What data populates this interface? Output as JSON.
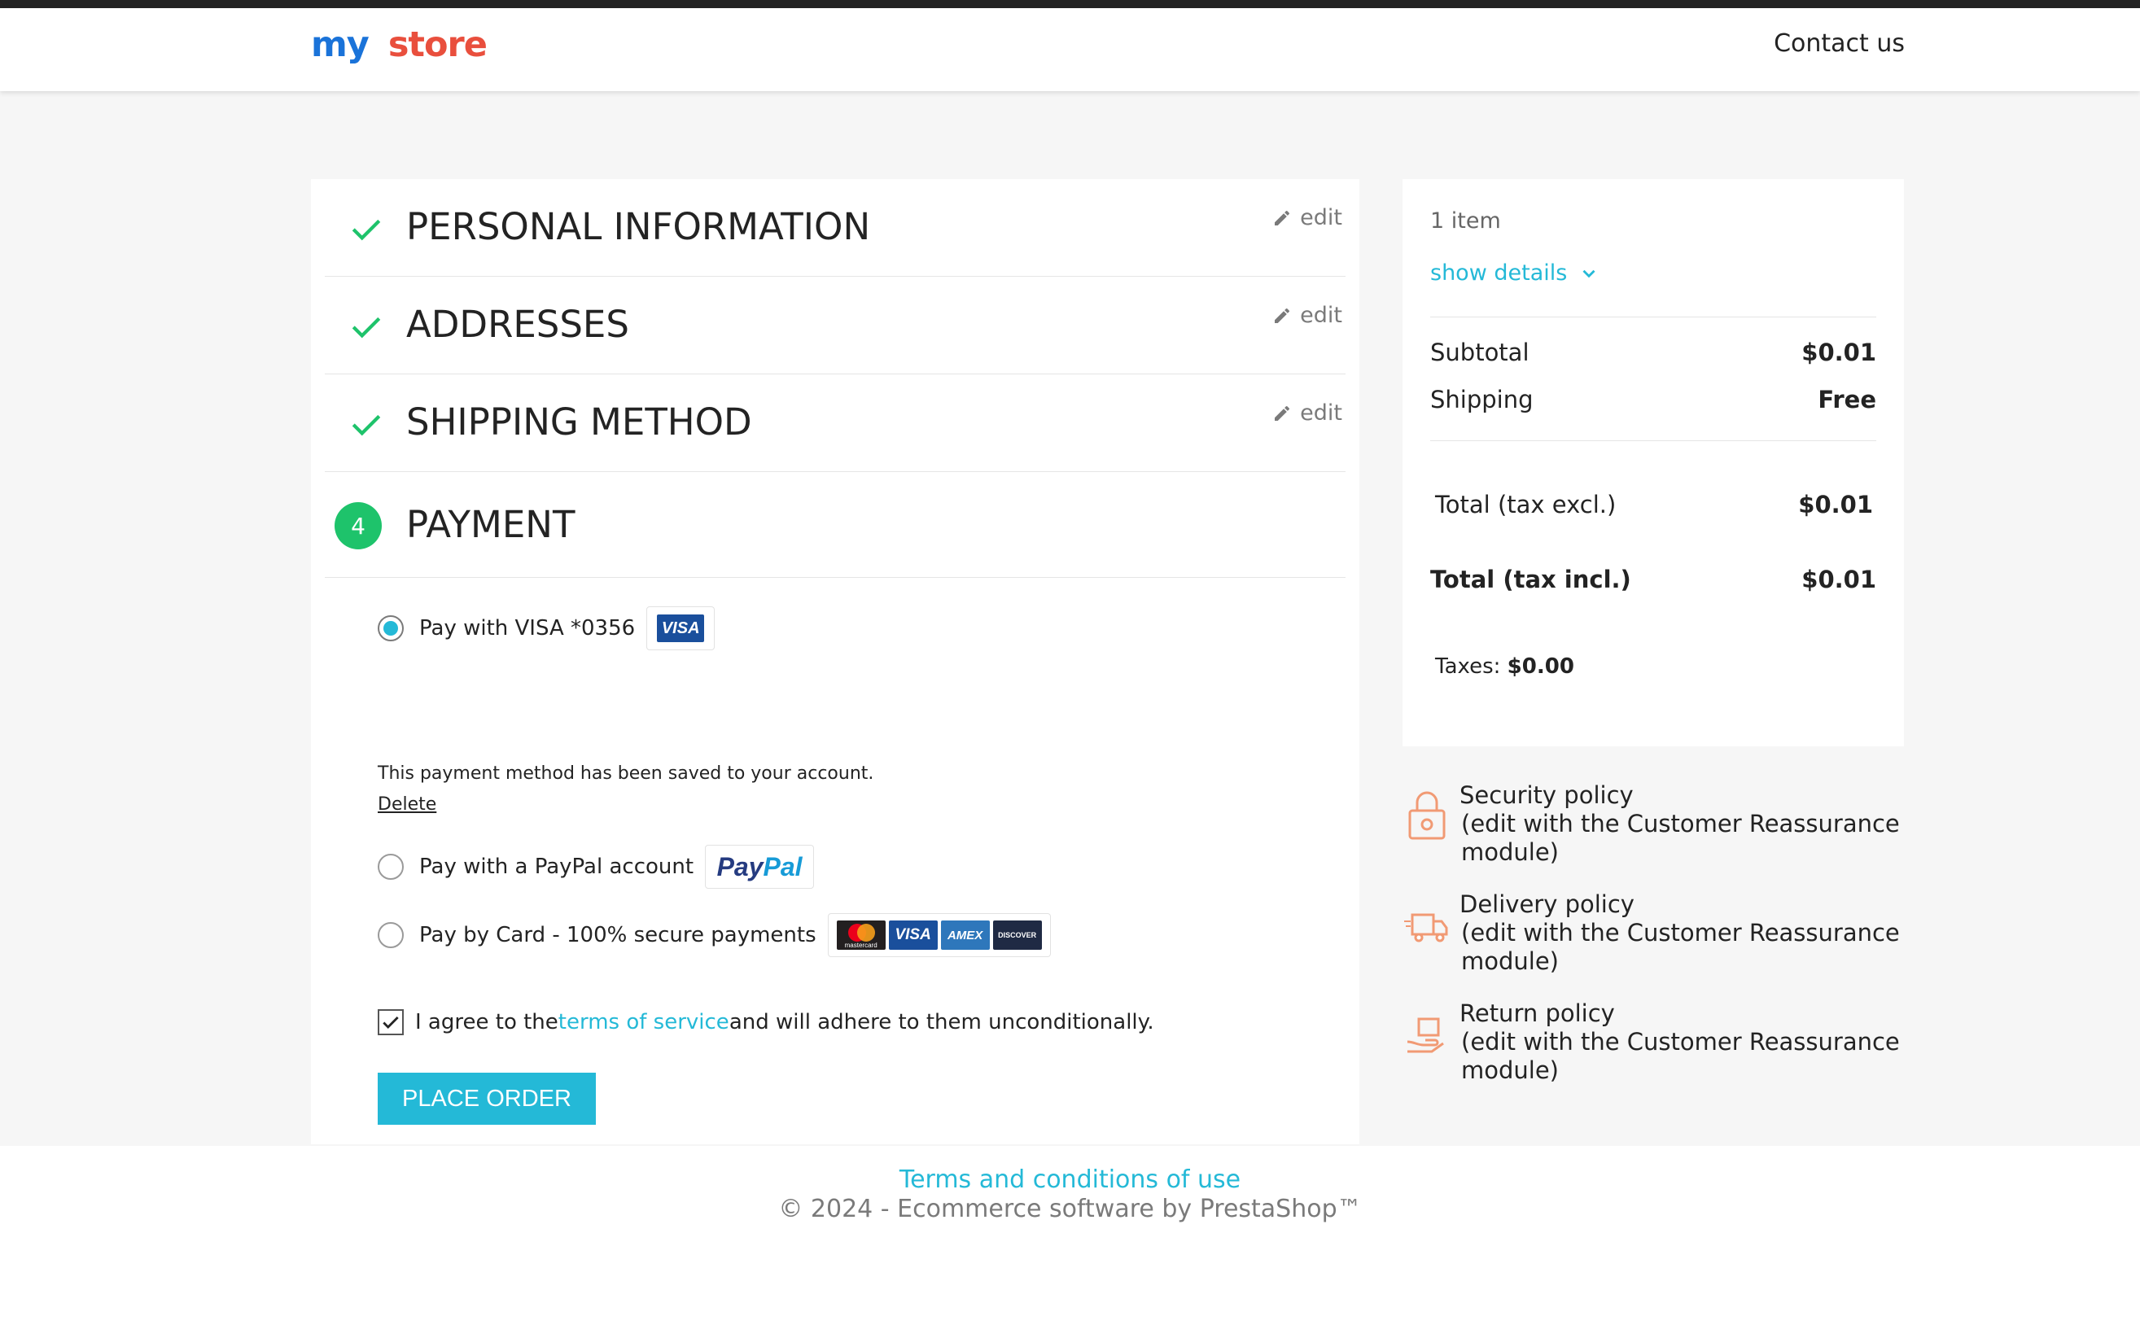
{
  "header": {
    "logo": {
      "word1": "my",
      "word2": "store"
    },
    "contact_label": "Contact us"
  },
  "steps": [
    {
      "title": "PERSONAL INFORMATION",
      "edit_label": "edit",
      "status": "complete"
    },
    {
      "title": "ADDRESSES",
      "edit_label": "edit",
      "status": "complete"
    },
    {
      "title": "SHIPPING METHOD",
      "edit_label": "edit",
      "status": "complete"
    },
    {
      "number": "4",
      "title": "PAYMENT",
      "status": "current"
    }
  ],
  "payment": {
    "options": [
      {
        "label": "Pay with VISA *0356",
        "selected": true,
        "logo": "visa"
      },
      {
        "label": "Pay with a PayPal account",
        "selected": false,
        "logo": "paypal"
      },
      {
        "label": "Pay by Card - 100% secure payments",
        "selected": false,
        "logo": "cards"
      }
    ],
    "saved_note": "This payment method has been saved to your account.",
    "delete_label": "Delete",
    "logos": {
      "visa": "VISA",
      "paypal_1": "Pay",
      "paypal_2": "Pal",
      "mastercard": "mastercard",
      "amex": "AMEX",
      "discover": "DISCOVER"
    },
    "agree": {
      "checked": true,
      "before": "I agree to the ",
      "link": "terms of service",
      "after": " and will adhere to them unconditionally."
    },
    "place_order_label": "PLACE ORDER"
  },
  "summary": {
    "items_count": "1 item",
    "show_details_label": "show details",
    "subtotal": {
      "label": "Subtotal",
      "value": "$0.01"
    },
    "shipping": {
      "label": "Shipping",
      "value": "Free"
    },
    "total_excl": {
      "label": "Total (tax excl.)",
      "value": "$0.01"
    },
    "total_incl": {
      "label": "Total (tax incl.)",
      "value": "$0.01"
    },
    "taxes": {
      "label": "Taxes: ",
      "value": "$0.00"
    }
  },
  "reassurance": [
    {
      "title": "Security policy",
      "desc": "(edit with the Customer Reassurance module)",
      "icon": "lock-icon"
    },
    {
      "title": "Delivery policy",
      "desc": "(edit with the Customer Reassurance module)",
      "icon": "delivery-truck-icon"
    },
    {
      "title": "Return policy",
      "desc": "(edit with the Customer Reassurance module)",
      "icon": "return-box-icon"
    }
  ],
  "footer": {
    "terms_label": "Terms and conditions of use",
    "copyright": "© 2024 - Ecommerce software by PrestaShop™"
  },
  "colors": {
    "accent": "#24b9d7",
    "success": "#1ec36b",
    "dark": "#232323"
  }
}
